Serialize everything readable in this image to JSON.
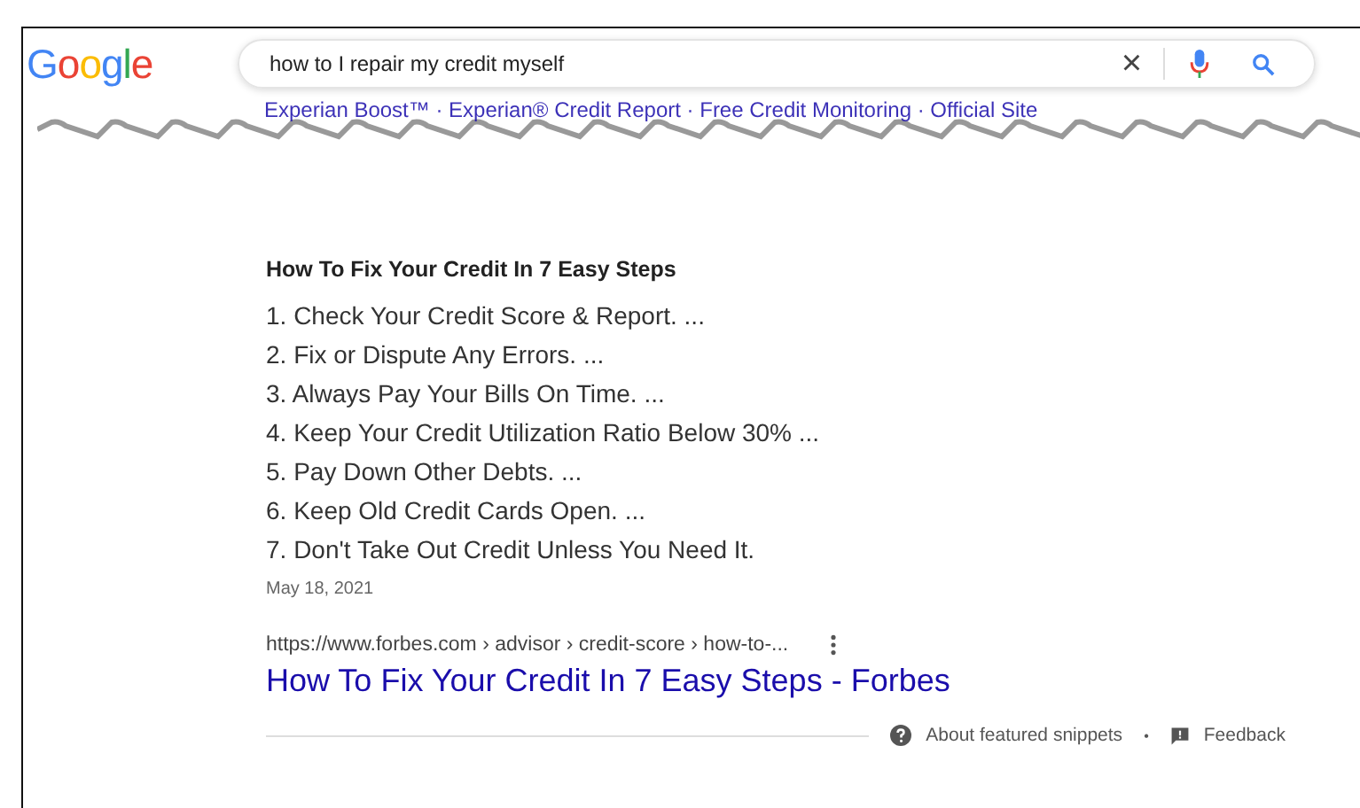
{
  "logo": "Google",
  "search": {
    "value": "how to I repair my credit myself",
    "clear": "×"
  },
  "ad_links": "Experian Boost™ · Experian® Credit Report · Free Credit Monitoring · Official Site",
  "snippet": {
    "title": "How To Fix Your Credit In 7 Easy Steps",
    "steps": [
      "1. Check Your Credit Score & Report. ...",
      "2. Fix or Dispute Any Errors. ...",
      "3. Always Pay Your Bills On Time. ...",
      "4. Keep Your Credit Utilization Ratio Below 30% ...",
      "5. Pay Down Other Debts. ...",
      "6. Keep Old Credit Cards Open. ...",
      "7. Don't Take Out Credit Unless You Need It."
    ],
    "date": "May 18, 2021",
    "url": "https://www.forbes.com › advisor › credit-score › how-to-...",
    "link": "How To Fix Your Credit In 7 Easy Steps - Forbes"
  },
  "footer": {
    "about": "About featured snippets",
    "separator": "•",
    "feedback": "Feedback"
  }
}
